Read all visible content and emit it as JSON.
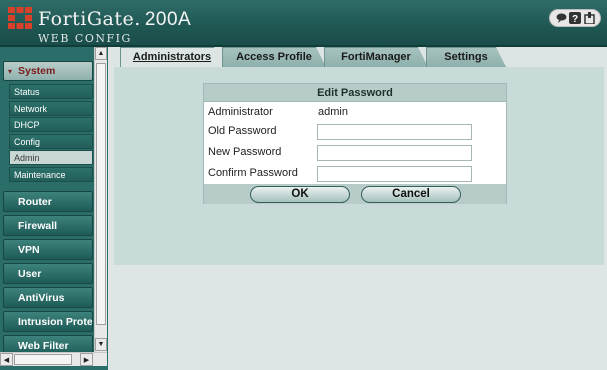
{
  "app": {
    "brand": "FortiGate.",
    "model": "200A",
    "subtitle": "WEB CONFIG",
    "header_icons": [
      "console-icon",
      "help-icon",
      "logout-icon"
    ]
  },
  "sidebar": {
    "sections": [
      {
        "label": "System",
        "expanded": true,
        "items": [
          "Status",
          "Network",
          "DHCP",
          "Config",
          "Admin",
          "Maintenance"
        ],
        "active_item": "Admin"
      },
      {
        "label": "Router"
      },
      {
        "label": "Firewall"
      },
      {
        "label": "VPN"
      },
      {
        "label": "User"
      },
      {
        "label": "AntiVirus"
      },
      {
        "label": "Intrusion Protection"
      },
      {
        "label": "Web Filter"
      }
    ]
  },
  "tabs": [
    {
      "label": "Administrators",
      "active": true
    },
    {
      "label": "Access Profile",
      "active": false
    },
    {
      "label": "FortiManager",
      "active": false
    },
    {
      "label": "Settings",
      "active": false
    }
  ],
  "dialog": {
    "title": "Edit Password",
    "fields": [
      {
        "label": "Administrator",
        "value": "admin",
        "readonly": true
      },
      {
        "label": "Old Password",
        "value": ""
      },
      {
        "label": "New Password",
        "value": ""
      },
      {
        "label": "Confirm Password",
        "value": ""
      }
    ],
    "ok_label": "OK",
    "cancel_label": "Cancel"
  },
  "colors": {
    "header": "#1f5753",
    "sidebar": "#2b6d68",
    "panel": "#c9dbd8",
    "accent_red": "#d9402a"
  }
}
